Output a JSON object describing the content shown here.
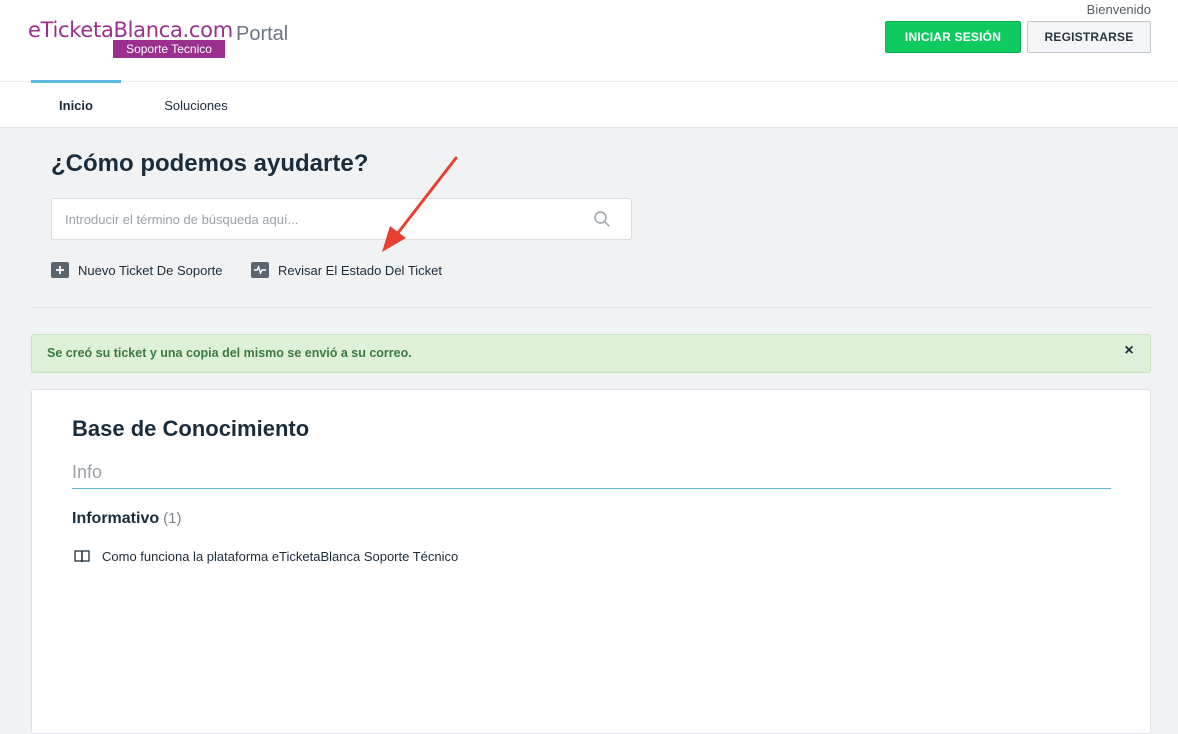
{
  "header": {
    "logo_main": "eTicketaBlanca.com",
    "logo_sub": "Soporte Tecnico",
    "portal_label": "Portal",
    "welcome": "Bienvenido",
    "login_label": "INICIAR SESIÓN",
    "register_label": "REGISTRARSE"
  },
  "nav": {
    "tabs": [
      {
        "label": "Inicio",
        "active": true
      },
      {
        "label": "Soluciones",
        "active": false
      }
    ]
  },
  "hero": {
    "title": "¿Cómo podemos ayudarte?",
    "search_placeholder": "Introducir el término de búsqueda aquí...",
    "search_value": "",
    "actions": [
      {
        "label": "Nuevo Ticket De Soporte",
        "icon": "plus-icon"
      },
      {
        "label": "Revisar El Estado Del Ticket",
        "icon": "pulse-icon"
      }
    ]
  },
  "alert": {
    "message": "Se creó su ticket y una copia del mismo se envió a su correo.",
    "close_symbol": "×"
  },
  "knowledge_base": {
    "title": "Base de Conocimiento",
    "tab": "Info",
    "categories": [
      {
        "name": "Informativo",
        "count": "(1)",
        "articles": [
          {
            "title": "Como funciona la plataforma eTicketaBlanca Soporte Técnico",
            "icon": "book-icon"
          }
        ]
      }
    ]
  },
  "colors": {
    "brand": "#9a2f8e",
    "login_button": "#0fcb5f",
    "active_tab": "#5bb8e0",
    "alert_bg": "#dff0d8",
    "alert_text": "#3c7a43",
    "annotation_arrow": "#e8402f"
  }
}
